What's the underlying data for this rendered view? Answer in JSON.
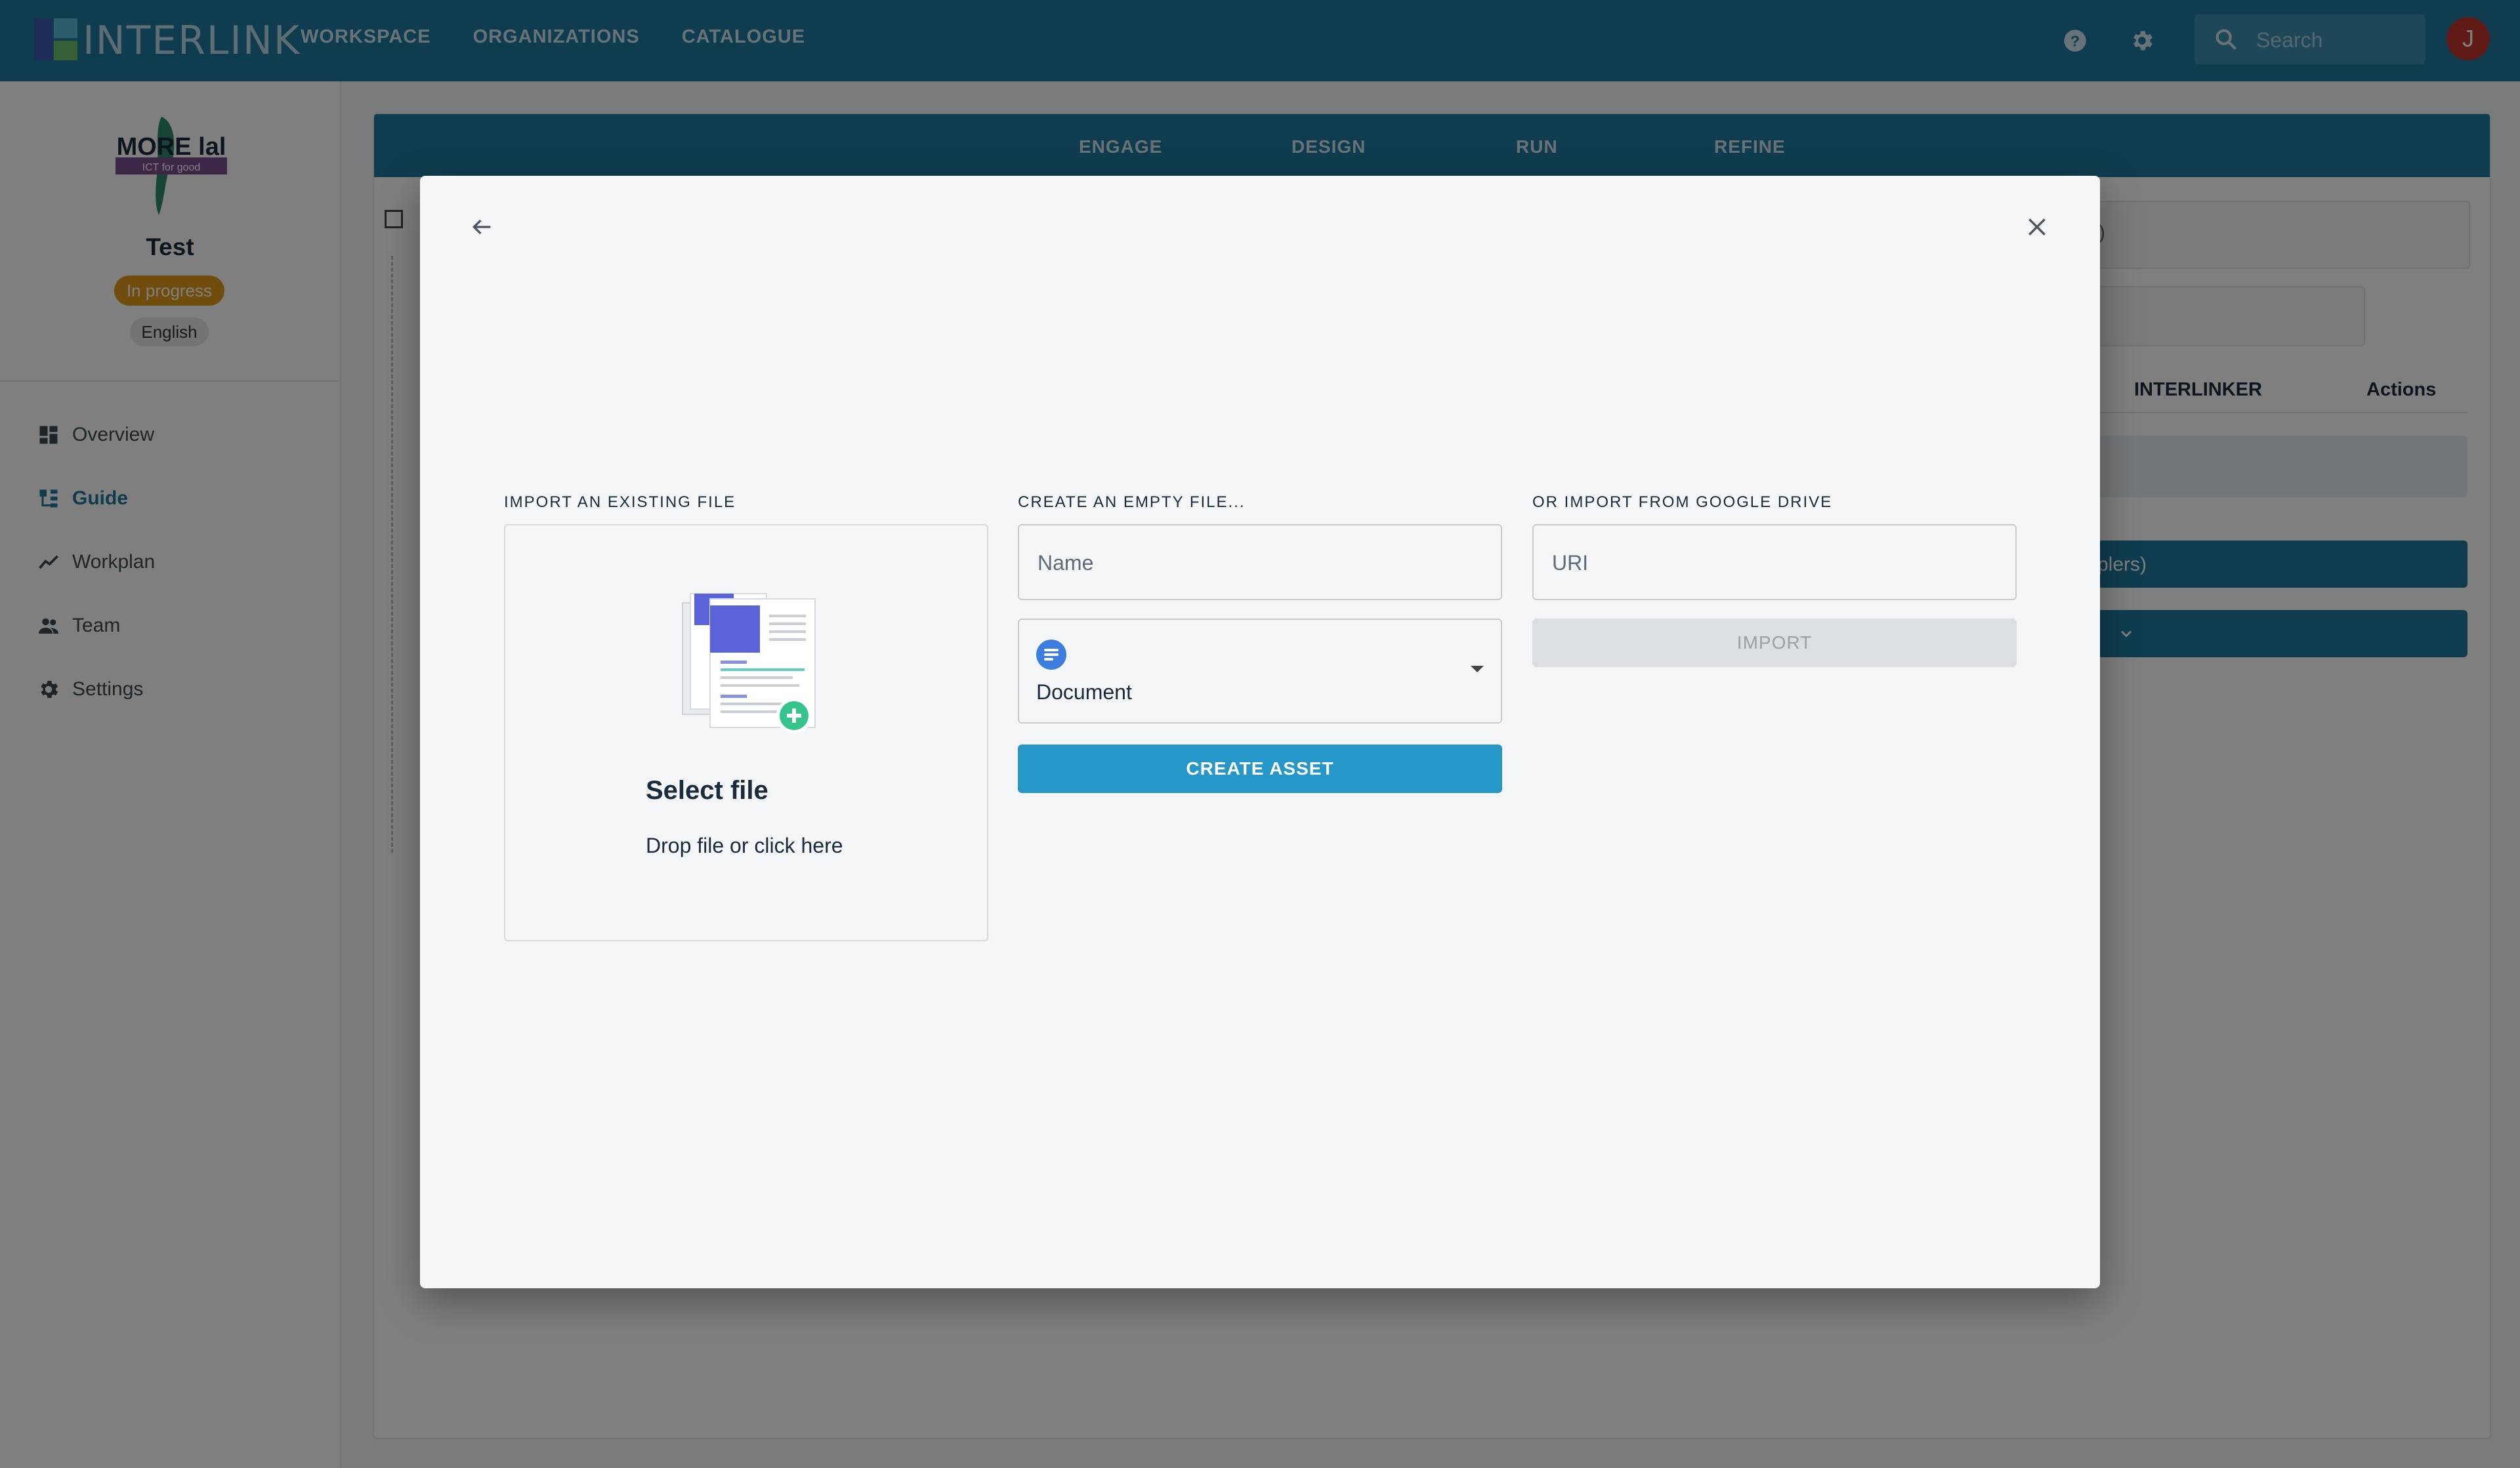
{
  "app": {
    "logo_text": "INTERLINK",
    "nav": [
      "WORKSPACE",
      "ORGANIZATIONS",
      "CATALOGUE"
    ],
    "search_placeholder": "Search",
    "avatar_initial": "J",
    "icons": [
      "help-icon",
      "gear-icon",
      "search-icon"
    ]
  },
  "sidebar": {
    "project_logo_text": "MORE lal",
    "project_logo_tagline": "ICT for good",
    "project_name": "Test",
    "status": "In progress",
    "language": "English",
    "items": [
      {
        "label": "Overview",
        "icon": "dashboard-icon",
        "active": false
      },
      {
        "label": "Guide",
        "icon": "tree-icon",
        "active": true
      },
      {
        "label": "Workplan",
        "icon": "timeline-icon",
        "active": false
      },
      {
        "label": "Team",
        "icon": "people-icon",
        "active": false
      },
      {
        "label": "Settings",
        "icon": "gear-icon",
        "active": false
      }
    ]
  },
  "background": {
    "phases": [
      "ENGAGE",
      "DESIGN",
      "RUN",
      "REFINE"
    ],
    "table_headers": [
      "INTERLINKER",
      "Actions"
    ],
    "partial_text_1": ")",
    "partial_button_text": "plers)"
  },
  "modal": {
    "import_existing": {
      "label": "IMPORT AN EXISTING FILE",
      "title": "Select file",
      "subtitle": "Drop file or click here"
    },
    "create_empty": {
      "label": "CREATE AN EMPTY FILE...",
      "name_placeholder": "Name",
      "type_selected": "Document",
      "button": "CREATE ASSET"
    },
    "google_drive": {
      "label": "OR IMPORT FROM GOOGLE DRIVE",
      "uri_placeholder": "URI",
      "button": "IMPORT"
    }
  },
  "colors": {
    "primary": "#1f7a9f",
    "accent_button": "#2597c9",
    "status_badge": "#e39a1b",
    "avatar": "#c2362f",
    "disabled_button": "#dcdfe2"
  }
}
